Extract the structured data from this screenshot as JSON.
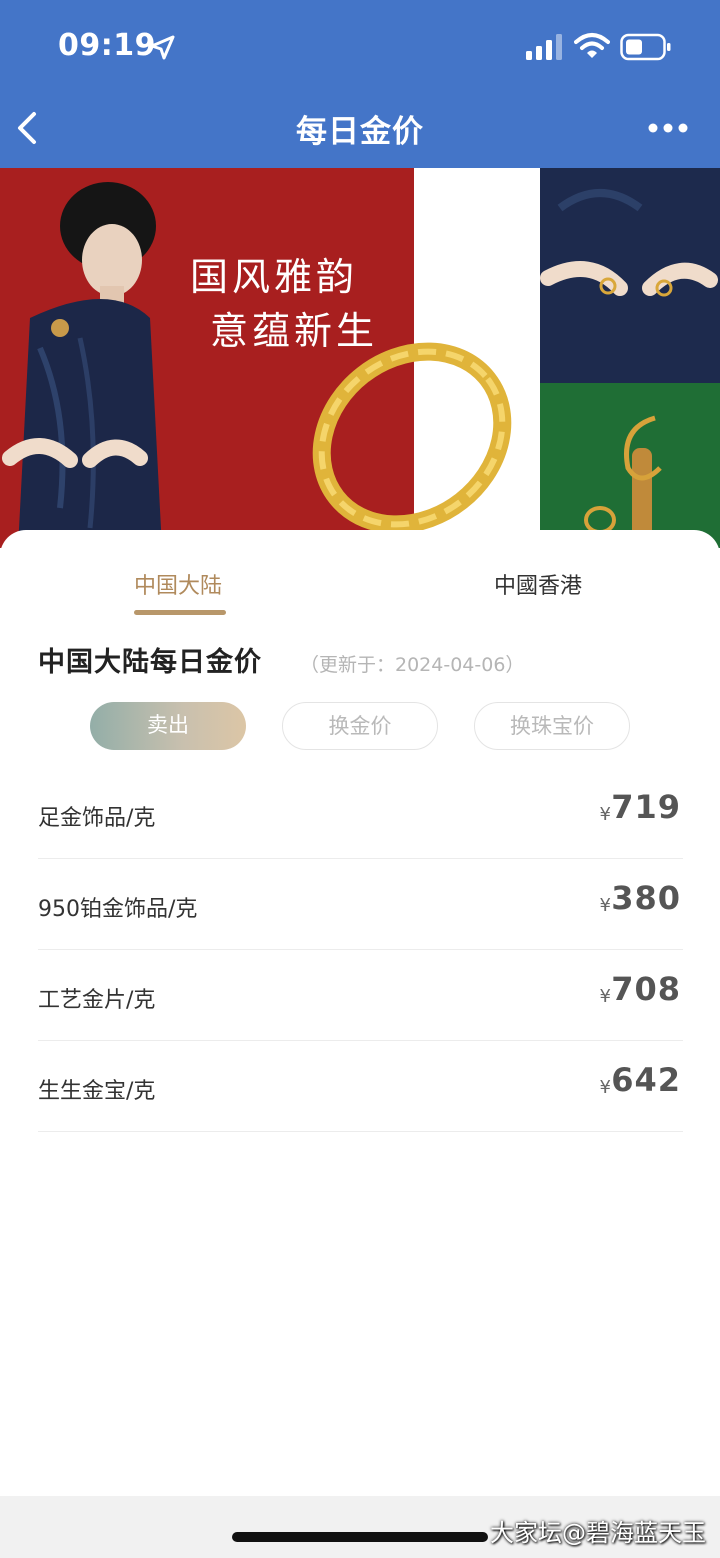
{
  "status_bar": {
    "time": "09:19"
  },
  "nav": {
    "title": "每日金价"
  },
  "banner": {
    "slogan_line1": "国风雅韵",
    "slogan_line2": "意蕴新生"
  },
  "tabs": [
    {
      "label": "中国大陆",
      "active": true
    },
    {
      "label": "中國香港",
      "active": false
    }
  ],
  "section": {
    "title": "中国大陆每日金价",
    "updated": "（更新于：2024-04-06）"
  },
  "chips": [
    {
      "label": "卖出",
      "active": true
    },
    {
      "label": "换金价",
      "active": false
    },
    {
      "label": "换珠宝价",
      "active": false
    }
  ],
  "currency_symbol": "¥",
  "prices": [
    {
      "label": "足金饰品/克",
      "value": "719"
    },
    {
      "label": "950铂金饰品/克",
      "value": "380"
    },
    {
      "label": "工艺金片/克",
      "value": "708"
    },
    {
      "label": "生生金宝/克",
      "value": "642"
    }
  ],
  "watermark": "大家坛@碧海蓝天玉",
  "colors": {
    "nav_bg": "#4475c8",
    "accent_gold": "#b08a5c",
    "banner_red": "#a81f1f",
    "banner_green": "#1f6e35"
  }
}
